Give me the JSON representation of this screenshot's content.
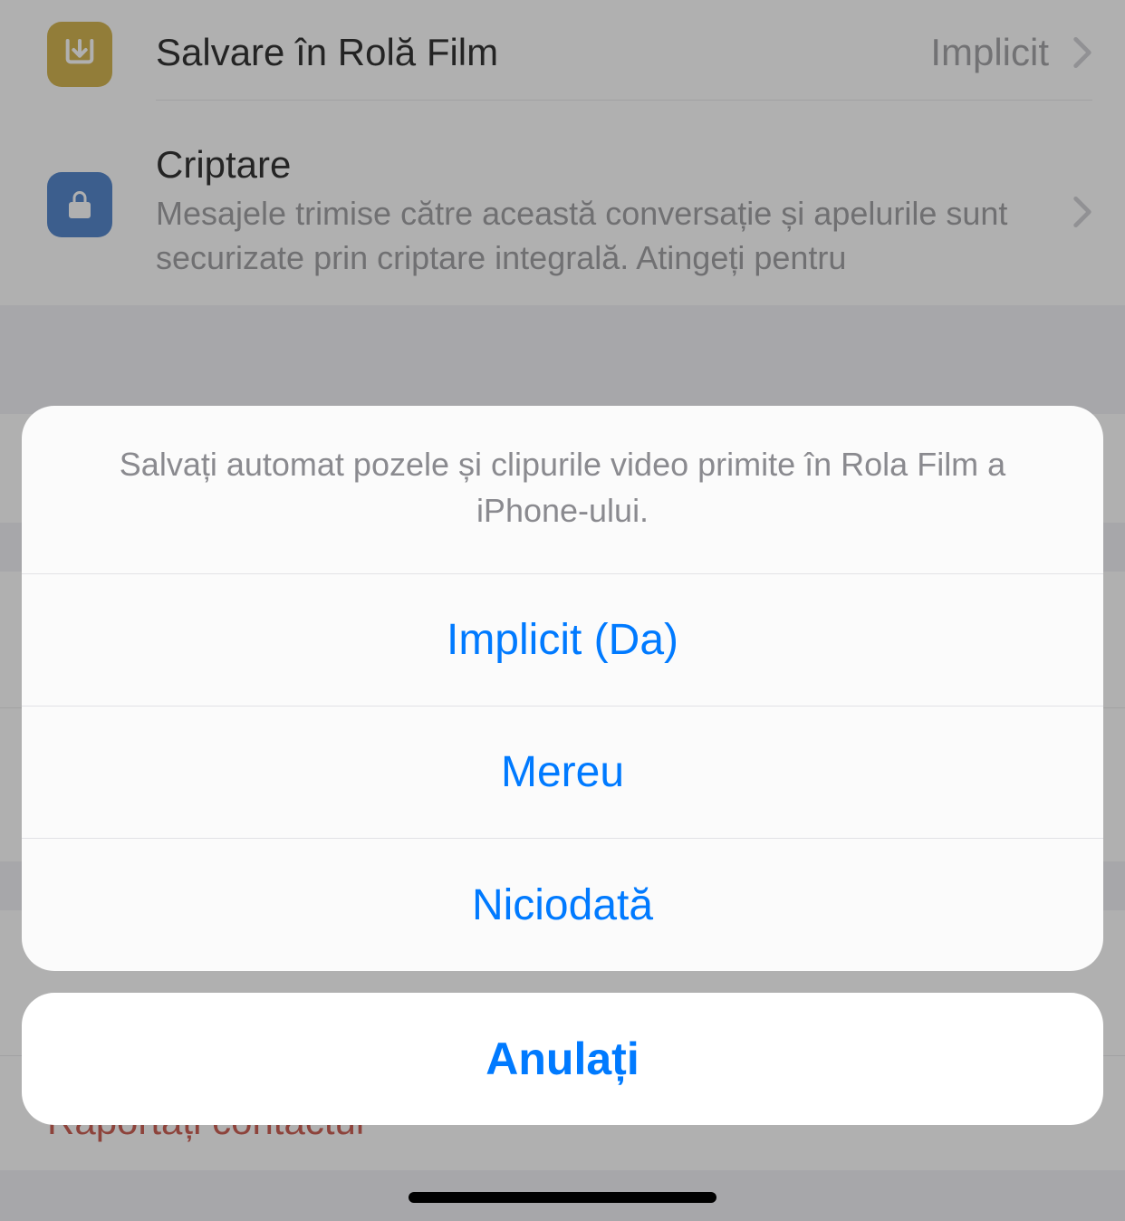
{
  "settings": {
    "saveToCameraRoll": {
      "label": "Salvare în Rolă Film",
      "value": "Implicit"
    },
    "encryption": {
      "title": "Criptare",
      "description": "Mesajele trimise către această conversație și apelurile sunt securizate prin criptare integrală. Atingeți pentru"
    },
    "reportContact": "Raportați contactul"
  },
  "actionSheet": {
    "headerText": "Salvați automat pozele și clipurile video primite în Rola Film a iPhone-ului.",
    "options": [
      "Implicit (Da)",
      "Mereu",
      "Niciodată"
    ],
    "cancel": "Anulați"
  }
}
